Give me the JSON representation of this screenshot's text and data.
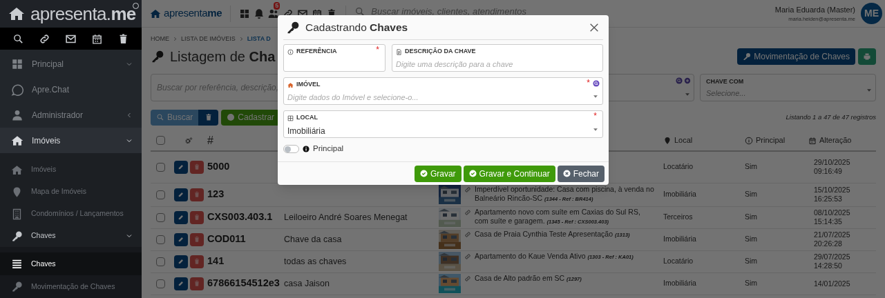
{
  "sidebar": {
    "logo": "apresenta.**me**",
    "items": [
      {
        "label": "Principal"
      },
      {
        "label": "Apre.Chat"
      },
      {
        "label": "Administrador"
      },
      {
        "label": "Imóveis",
        "expanded": true,
        "children": [
          {
            "label": "Imóveis",
            "selected": false
          },
          {
            "label": "Mapa de Imóveis",
            "selected": false
          },
          {
            "label": "Condomínios / Lançamentos",
            "selected": false
          },
          {
            "label": "Chaves",
            "expanded": true,
            "children": [
              {
                "label": "Chaves",
                "selected": true
              },
              {
                "label": "Movimentação de Chaves",
                "selected": false
              }
            ]
          }
        ]
      }
    ]
  },
  "header": {
    "logo": "apresenta**me**",
    "badge": "5",
    "search_placeholder": "Buscar imóveis, clientes, atendimentos",
    "user_name": "Maria Eduarda (Master)",
    "user_email": "maria.heiden@apresenta.me",
    "avatar": "ME"
  },
  "breadcrumb": [
    {
      "label": "HOME",
      "current": false
    },
    {
      "label": "LISTA DE IMÓVEIS",
      "current": false
    },
    {
      "label": "LISTA D",
      "current": true
    }
  ],
  "title": "Listagem de **Cha**",
  "movement_button": "Movimentação de Chaves",
  "filters": {
    "search_placeholder": "Buscar por referência, descrição,",
    "chave_com": {
      "label": "CHAVE COM",
      "placeholder": "Selecione..."
    }
  },
  "search_button": "Buscar",
  "create_button": "Cadastrar",
  "record_count": "Listando 1 a 47 de 47 registros",
  "table": {
    "select_all_checked": false,
    "columns": [
      "#",
      "Local",
      "Principal",
      "Alteração"
    ],
    "rows": [
      {
        "checked": false,
        "ref": "5000",
        "local": "Locatário",
        "principal": "Sim",
        "date": "29/10/2025",
        "time": "09:16:49"
      },
      {
        "checked": false,
        "ref": "123",
        "property": "Imperdível oportunidade: Casa com piscina, à venda no Balneário Rincão-SC",
        "property_ref": "(1344 - Ref : BR414)",
        "local": "Imobiliária",
        "principal": "Sim",
        "date": "15/10/2025",
        "time": "16:25:53"
      },
      {
        "checked": false,
        "ref": "CXS003.403.1",
        "description": "Leiloeiro André Soares Menegat",
        "property": "Apartamento novo com suíte em Caxias do Sul RS, com suíte e garagem.",
        "property_ref": "(1345 - Ref : CXS003.403)",
        "local": "Terceiros",
        "principal": "Sim",
        "date": "08/10/2025",
        "time": "15:14:35"
      },
      {
        "checked": false,
        "ref": "COD011",
        "description": "Chave da casa",
        "property": "Casa de Praia Cynthia Teste Apresentação",
        "property_ref": "(1313)",
        "local": "Imobiliária",
        "principal": "Sim",
        "date": "21/07/2025",
        "time": "20:26:28"
      },
      {
        "checked": false,
        "ref": "141",
        "description": "todas as chaves",
        "property": "Apartamento do Kaue Venda Ativo",
        "property_ref": "(1303 - Ref : KA01)",
        "local": "Locatário",
        "principal": "Sim",
        "date": "29/07/2025",
        "time": "14:28:50"
      },
      {
        "checked": false,
        "ref": "67866154512e3",
        "description": "casa Jaison",
        "property": "Casa de Alto padrão em SC",
        "property_ref": "(1297)",
        "local": "Imobiliária",
        "principal": "Sim",
        "date": "14/01/2025"
      }
    ]
  },
  "modal": {
    "title": "Cadastrando **Chaves**",
    "fields": [
      {
        "kind": "text",
        "label": "REFERÊNCIA",
        "required_mark": "*"
      },
      {
        "kind": "text",
        "label": "DESCRIÇÃO DA CHAVE",
        "placeholder": "Digite uma descrição para a chave"
      },
      {
        "kind": "select",
        "label": "IMÓVEL",
        "required_mark": "*",
        "placeholder": "Digite dados do Imóvel e selecione-o..."
      },
      {
        "kind": "select",
        "label": "LOCAL",
        "required_mark": "*",
        "value": "Imobiliária"
      }
    ],
    "toggle": {
      "label": "Principal",
      "on": false
    },
    "buttons": [
      {
        "kind": "save",
        "label": "Gravar"
      },
      {
        "kind": "save",
        "label": "Gravar e Continuar"
      },
      {
        "kind": "close",
        "label": "Fechar"
      }
    ]
  }
}
